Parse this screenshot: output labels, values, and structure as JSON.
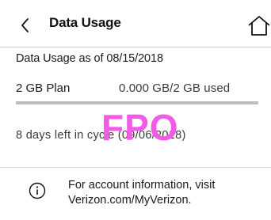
{
  "header": {
    "back_icon": "chevron-left-icon",
    "title": "Data Usage",
    "home_icon": "home-icon"
  },
  "usage": {
    "as_of": "Data Usage as of 08/15/2018",
    "plan_label": "2 GB Plan",
    "used_text": "0.000 GB/2 GB used",
    "used_fraction": 0,
    "bar_color": "#bdbdbd",
    "fill_color": "#333333"
  },
  "cycle": {
    "days_left": "8 days left in cycle (09/06/2018)"
  },
  "watermark": {
    "text": "FPO",
    "color": "#f25be8"
  },
  "info": {
    "icon": "info-icon",
    "line1": "For account information, visit",
    "line2": "Verizon.com/MyVerizon."
  }
}
